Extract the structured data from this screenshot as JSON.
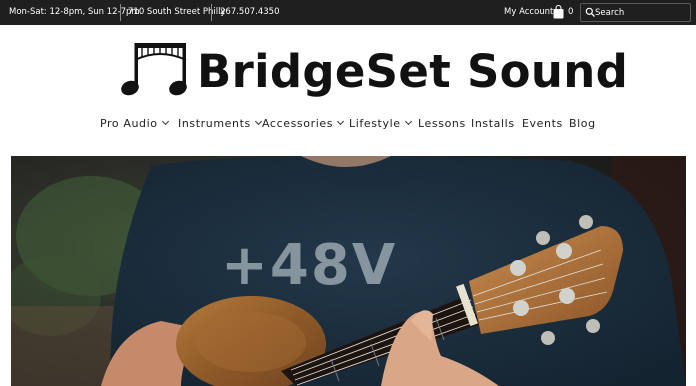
{
  "topbar": {
    "hours": "Mon-Sat: 12-8pm, Sun 12-7pm",
    "address": "710 South Street Philly",
    "phone": "267.507.4350",
    "account": "My Account",
    "cart_count": "0",
    "search_placeholder": "Search"
  },
  "brand": {
    "name": "BridgeSet Sound"
  },
  "nav": {
    "pro_audio": "Pro Audio",
    "instruments": "Instruments",
    "accessories": "Accessories",
    "lifestyle": "Lifestyle",
    "lessons": "Lessons",
    "installs": "Installs",
    "events": "Events",
    "blog": "Blog"
  },
  "hero": {
    "shirt_text": "+48V"
  }
}
